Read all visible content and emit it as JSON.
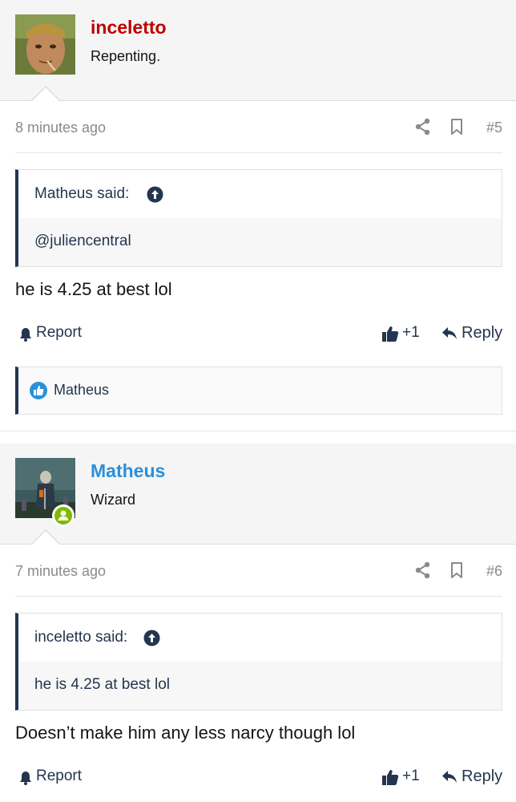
{
  "posts": [
    {
      "username": "inceletto",
      "user_title": "Repenting.",
      "time": "8 minutes ago",
      "post_number": "#5",
      "quote_author": "Matheus said:",
      "quote_text": "@juliencentral",
      "message": "he is 4.25 at best lol",
      "report_label": "Report",
      "like_label": "+1",
      "reply_label": "Reply",
      "reaction_user": "Matheus"
    },
    {
      "username": "Matheus",
      "user_title": "Wizard",
      "time": "7 minutes ago",
      "post_number": "#6",
      "quote_author": "inceletto said:",
      "quote_text": "he is 4.25 at best lol",
      "message": "Doesn’t make him any less narcy though lol",
      "report_label": "Report",
      "like_label": "+1",
      "reply_label": "Reply"
    }
  ],
  "icons": {
    "share": "share-icon",
    "bookmark": "bookmark-icon",
    "quote_up": "arrow-up-circle-icon",
    "report": "bell-icon",
    "like": "thumbs-up-icon",
    "reply": "reply-arrow-icon",
    "reaction": "like-badge-icon",
    "online": "online-status-icon"
  },
  "colors": {
    "accent": "#24364f",
    "username_red": "#c00000",
    "username_blue": "#2b90d9",
    "online_green": "#7fb900",
    "like_blue": "#2b90d9"
  }
}
